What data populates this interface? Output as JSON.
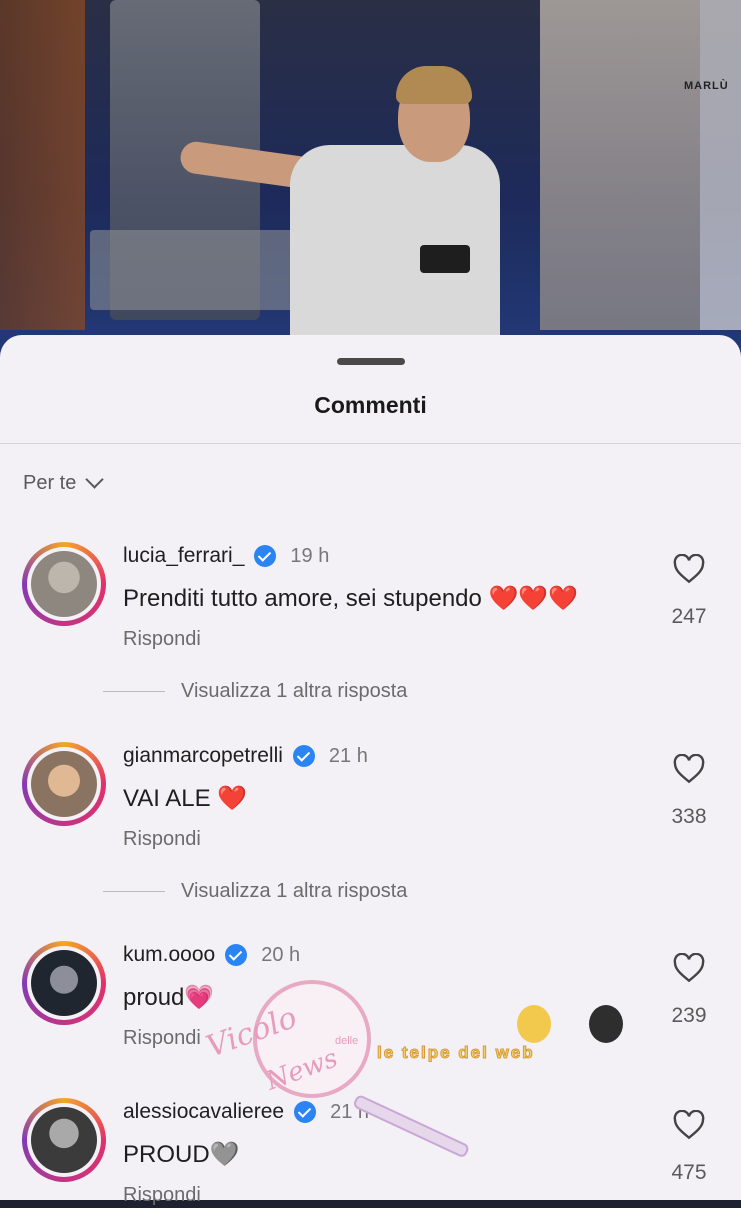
{
  "background": {
    "brand_text": "MARLÙ"
  },
  "sheet": {
    "title": "Commenti",
    "sort_label": "Per te"
  },
  "comments": [
    {
      "username": "lucia_ferrari_",
      "time": "19 h",
      "text": "Prenditi tutto amore, sei stupendo",
      "emoji": "❤️❤️❤️",
      "reply_label": "Rispondi",
      "likes": "247",
      "view_more": "Visualizza 1 altra risposta"
    },
    {
      "username": "gianmarcopetrelli",
      "time": "21 h",
      "text": "VAI ALE",
      "emoji": "❤️",
      "reply_label": "Rispondi",
      "likes": "338",
      "view_more": "Visualizza 1 altra risposta"
    },
    {
      "username": "kum.oooo",
      "time": "20 h",
      "text": "proud",
      "emoji": "💗",
      "reply_label": "Rispondi",
      "likes": "239"
    },
    {
      "username": "alessiocavalieree",
      "time": "21 h",
      "text": "PROUD",
      "emoji": "🩶",
      "reply_label": "Rispondi",
      "likes": "475"
    }
  ],
  "watermark": {
    "line1": "Vicolo",
    "small": "delle",
    "line2": "News",
    "caption": "le telpe del web"
  },
  "colors": {
    "verified": "#2a84f4",
    "heart": "#e0201f",
    "story_ring": [
      "#f5a623",
      "#e1306c",
      "#833ab4"
    ]
  }
}
